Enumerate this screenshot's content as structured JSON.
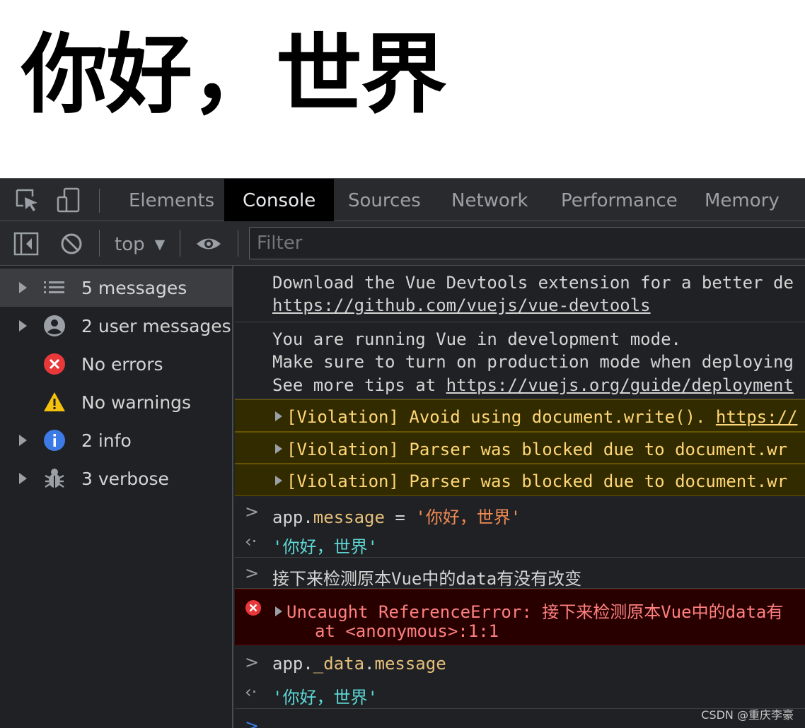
{
  "page": {
    "heading": "你好，世界"
  },
  "devtools": {
    "tabs": [
      "Elements",
      "Console",
      "Sources",
      "Network",
      "Performance",
      "Memory"
    ],
    "active_tab": "Console",
    "toolbar": {
      "context": "top",
      "filter_placeholder": "Filter"
    },
    "sidebar": [
      {
        "label": "5 messages",
        "icon": "list-icon",
        "expandable": true,
        "selected": true
      },
      {
        "label": "2 user messages",
        "icon": "user-icon",
        "expandable": true
      },
      {
        "label": "No errors",
        "icon": "error-icon",
        "expandable": false
      },
      {
        "label": "No warnings",
        "icon": "warning-icon",
        "expandable": false
      },
      {
        "label": "2 info",
        "icon": "info-icon",
        "expandable": true
      },
      {
        "label": "3 verbose",
        "icon": "bug-icon",
        "expandable": true
      }
    ],
    "console": {
      "devtools_msg": {
        "line1": "Download the Vue Devtools extension for a better de",
        "link": "https://github.com/vuejs/vue-devtools"
      },
      "dev_mode_msg": {
        "line1": "You are running Vue in development mode.",
        "line2": "Make sure to turn on production mode when deploying",
        "line3_prefix": "See more tips at ",
        "line3_link": "https://vuejs.org/guide/deployment"
      },
      "violations": [
        {
          "text": "[Violation] Avoid using document.write(). ",
          "link": "https://"
        },
        {
          "text": "[Violation] Parser was blocked due to document.wr",
          "link": ""
        },
        {
          "text": "[Violation] Parser was blocked due to document.wr",
          "link": ""
        }
      ],
      "cmd1": {
        "obj": "app.",
        "prop": "message",
        "op": " = ",
        "value": "'你好，世界'"
      },
      "result1": "'你好，世界'",
      "cmd2": "接下来检测原本Vue中的data有没有改变",
      "error": {
        "line1": "Uncaught ReferenceError: 接下来检测原本Vue中的data有",
        "line2": "at <anonymous>:1:1"
      },
      "cmd3": {
        "obj": "app.",
        "prop": "_data",
        "dot": ".",
        "prop2": "message"
      },
      "result3": "'你好，世界'"
    },
    "watermark": "CSDN @重庆李豪"
  }
}
